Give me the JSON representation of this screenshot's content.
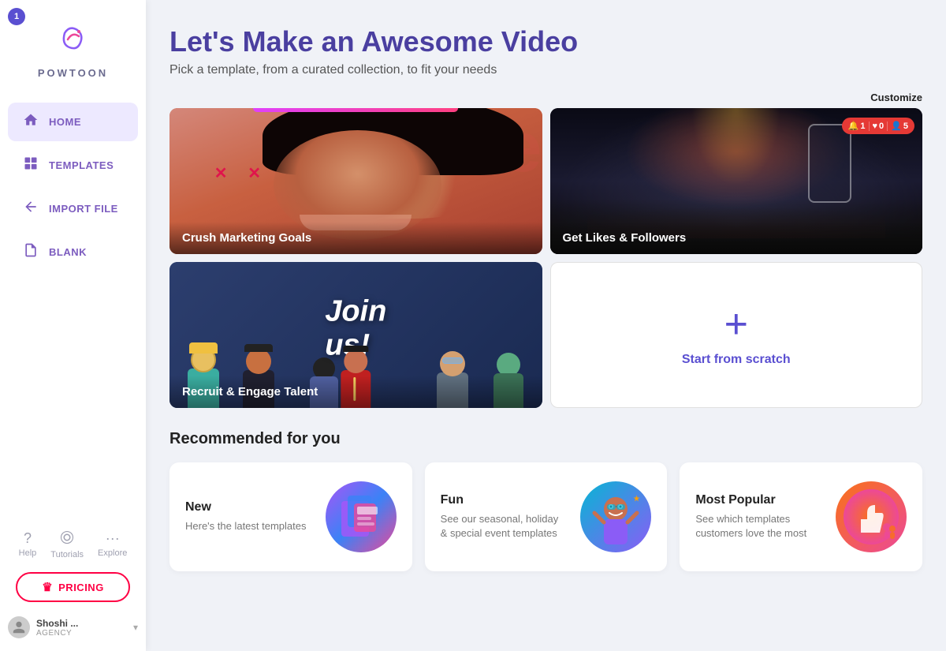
{
  "sidebar": {
    "logo_text": "POWTOON",
    "nav_items": [
      {
        "id": "home",
        "label": "HOME",
        "icon": "home",
        "active": true
      },
      {
        "id": "templates",
        "label": "TEMPLATES",
        "icon": "templates",
        "active": false
      },
      {
        "id": "import",
        "label": "IMPORT FILE",
        "icon": "import",
        "active": false
      },
      {
        "id": "blank",
        "label": "BLANK",
        "icon": "blank",
        "active": false
      }
    ],
    "help": [
      {
        "id": "help",
        "label": "Help",
        "icon": "?"
      },
      {
        "id": "tutorials",
        "label": "Tutorials",
        "icon": "👁"
      },
      {
        "id": "explore",
        "label": "Explore",
        "icon": "..."
      }
    ],
    "pricing_label": "PRICING",
    "user": {
      "name": "Shoshi ...",
      "role": "AGENCY"
    }
  },
  "main": {
    "title": "Let's Make an Awesome Video",
    "subtitle": "Pick a template, from a curated collection, to fit your needs",
    "customize_label": "Customize",
    "templates": [
      {
        "id": "crush",
        "label": "Crush Marketing Goals"
      },
      {
        "id": "likes",
        "label": "Get Likes & Followers"
      },
      {
        "id": "recruit",
        "label": "Recruit & Engage Talent"
      },
      {
        "id": "scratch",
        "label": "Start from scratch",
        "plus": "+"
      }
    ],
    "recommended_title": "Recommended for you",
    "recommended": [
      {
        "id": "new",
        "title": "New",
        "desc": "Here's the latest templates"
      },
      {
        "id": "fun",
        "title": "Fun",
        "desc": "See our seasonal, holiday & special event templates"
      },
      {
        "id": "popular",
        "title": "Most Popular",
        "desc": "See which templates customers love the most"
      }
    ]
  },
  "colors": {
    "accent": "#5a4fd1",
    "primary_text": "#4a3fa0",
    "sidebar_bg": "#ffffff",
    "main_bg": "#f0f2f7",
    "nav_active_bg": "#ede9ff",
    "pricing_color": "#ff0044"
  }
}
